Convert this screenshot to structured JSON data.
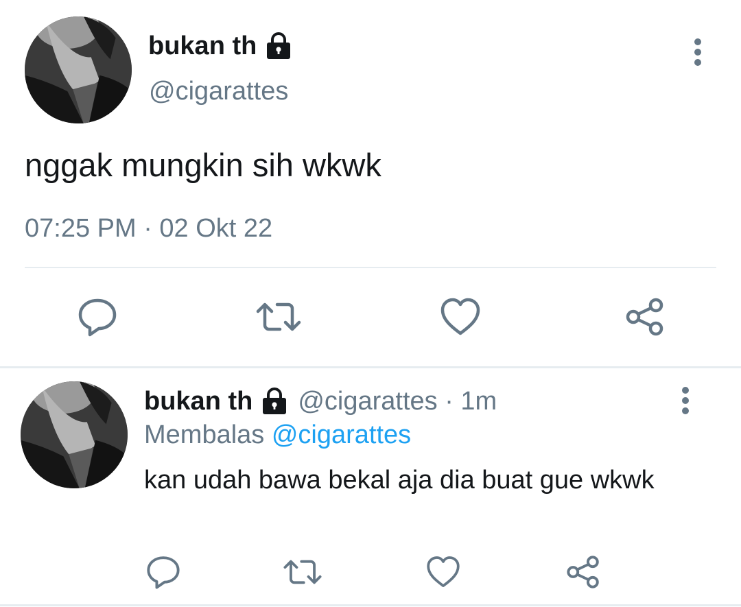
{
  "colors": {
    "text_primary": "#14171a",
    "text_secondary": "#657786",
    "icon_gray": "#657786",
    "mention_blue": "#1da1f2",
    "divider": "#e6ecf0"
  },
  "main_tweet": {
    "display_name": "bukan th",
    "handle": "@cigarattes",
    "text": "nggak mungkin sih wkwk",
    "timestamp": "07:25 PM · 02 Okt 22",
    "icons": {
      "avatar": "avatar",
      "lock": "lock-icon",
      "more": "more-vertical-icon",
      "reply": "reply-icon",
      "retweet": "retweet-icon",
      "like": "like-icon",
      "share": "share-icon"
    }
  },
  "reply_tweet": {
    "display_name": "bukan th",
    "handle_time": "@cigarattes · 1m",
    "replying_prefix": "Membalas",
    "replying_to": "@cigarattes",
    "text": "kan udah bawa bekal aja dia buat gue wkwk",
    "icons": {
      "avatar": "avatar",
      "lock": "lock-icon",
      "more": "more-vertical-icon",
      "reply": "reply-icon",
      "retweet": "retweet-icon",
      "like": "like-icon",
      "share": "share-icon"
    }
  }
}
